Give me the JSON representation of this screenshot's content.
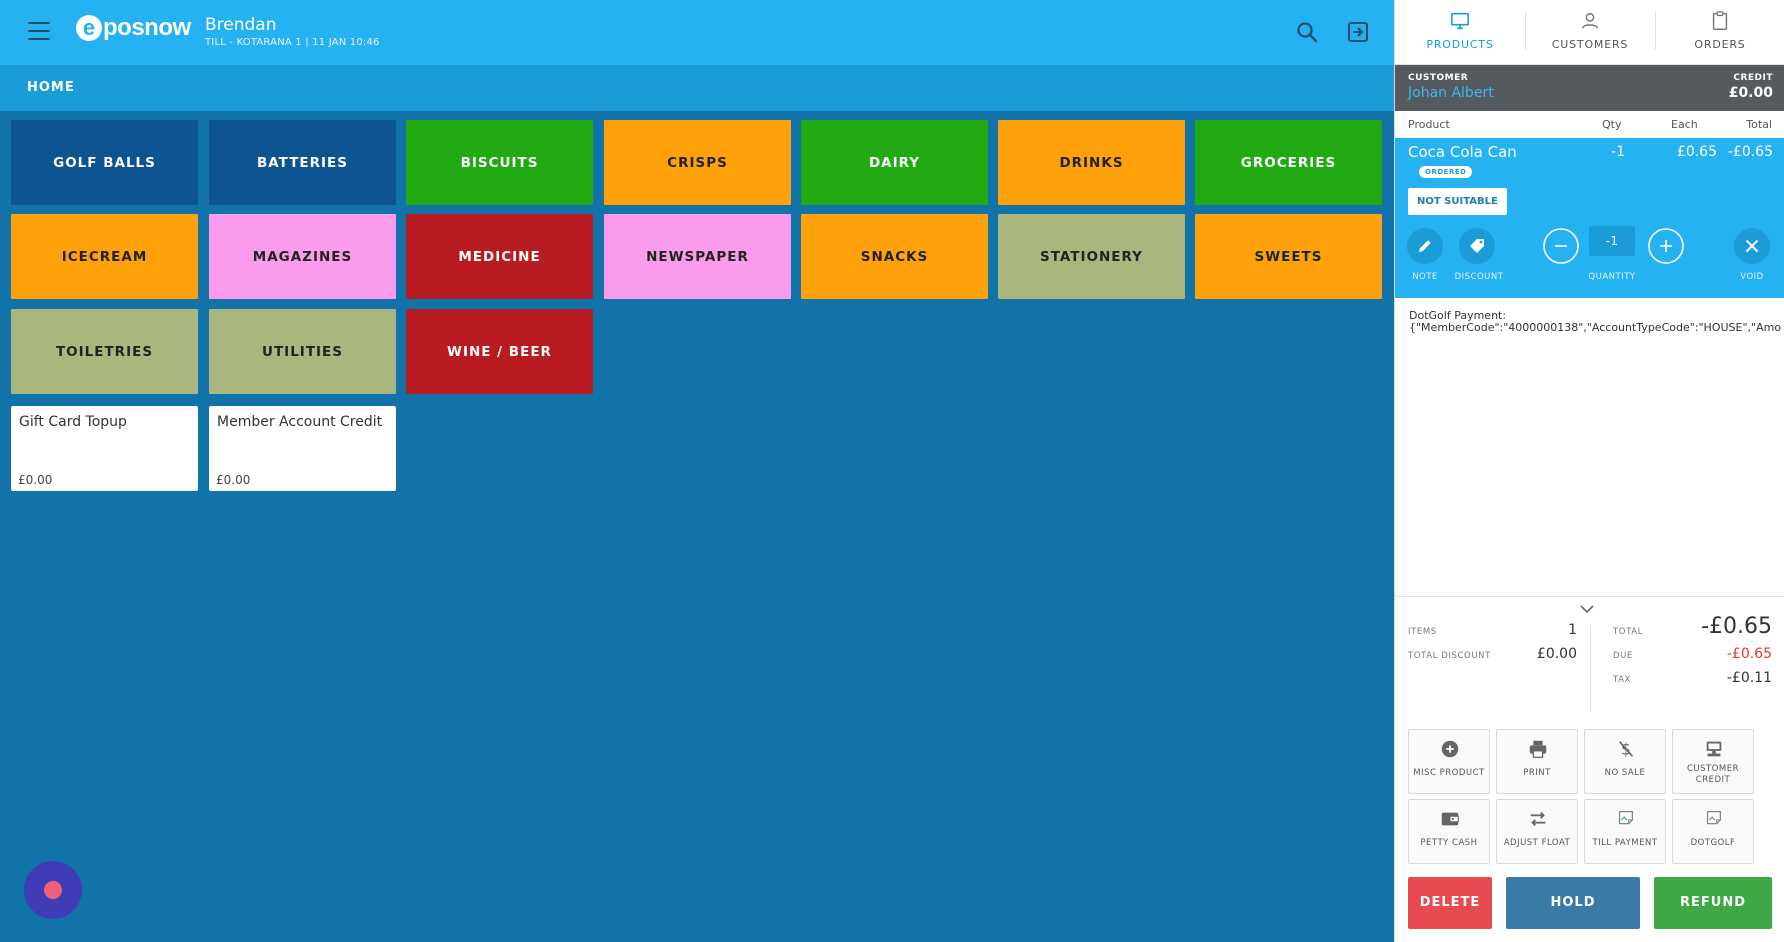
{
  "header": {
    "logo_letter": "e",
    "logo_text": "posnow",
    "user_name": "Brendan",
    "till_info": "TILL - KOTARANA 1 | 11 JAN 10:46"
  },
  "breadcrumb": "HOME",
  "categories": [
    {
      "label": "GOLF BALLS",
      "color": "#0d5491"
    },
    {
      "label": "BATTERIES",
      "color": "#0d5491"
    },
    {
      "label": "BISCUITS",
      "color": "#22aa12"
    },
    {
      "label": "CRISPS",
      "color": "#ffa10a"
    },
    {
      "label": "DAIRY",
      "color": "#22aa12"
    },
    {
      "label": "DRINKS",
      "color": "#ffa10a"
    },
    {
      "label": "GROCERIES",
      "color": "#22aa12"
    },
    {
      "label": "ICECREAM",
      "color": "#ffa10a"
    },
    {
      "label": "MAGAZINES",
      "color": "#fa9beb"
    },
    {
      "label": "MEDICINE",
      "color": "#b81c20"
    },
    {
      "label": "NEWSPAPER",
      "color": "#fa9beb"
    },
    {
      "label": "SNACKS",
      "color": "#ffa10a"
    },
    {
      "label": "STATIONERY",
      "color": "#a9b77e"
    },
    {
      "label": "SWEETS",
      "color": "#ffa10a"
    },
    {
      "label": "TOILETRIES",
      "color": "#a9b77e"
    },
    {
      "label": "UTILITIES",
      "color": "#a9b77e"
    },
    {
      "label": "WINE / BEER",
      "color": "#b81c20"
    }
  ],
  "products": [
    {
      "name": "Gift Card Topup",
      "price": "£0.00"
    },
    {
      "name": "Member Account Credit",
      "price": "£0.00"
    }
  ],
  "panel_tabs": [
    "PRODUCTS",
    "CUSTOMERS",
    "ORDERS"
  ],
  "customer": {
    "label": "CUSTOMER",
    "name": "Johan Albert",
    "credit_label": "CREDIT",
    "credit_value": "£0.00"
  },
  "columns": {
    "product": "Product",
    "qty": "Qty",
    "each": "Each",
    "total": "Total"
  },
  "order_line": {
    "name": "Coca Cola Can",
    "qty": "-1",
    "each": "£0.65",
    "total": "-£0.65",
    "badge": "ORDERED",
    "not_suitable": "NOT SUITABLE",
    "note_label": "NOTE",
    "discount_label": "DISCOUNT",
    "quantity_label": "QUANTITY",
    "quantity_value": "-1",
    "void_label": "VOID"
  },
  "note_text_line1": "DotGolf Payment:",
  "note_text_line2": "{\"MemberCode\":\"4000000138\",\"AccountTypeCode\":\"HOUSE\",\"Amo",
  "summary": {
    "items_label": "ITEMS",
    "items_value": "1",
    "discount_label": "TOTAL DISCOUNT",
    "discount_value": "£0.00",
    "total_label": "TOTAL",
    "total_value": "-£0.65",
    "due_label": "DUE",
    "due_value": "-£0.65",
    "tax_label": "TAX",
    "tax_value": "-£0.11"
  },
  "actions": {
    "misc_product": "MISC PRODUCT",
    "print": "PRINT",
    "no_sale": "NO SALE",
    "customer_credit_1": "CUSTOMER",
    "customer_credit_2": "CREDIT",
    "petty_cash": "PETTY CASH",
    "adjust_float": "ADJUST FLOAT",
    "till_payment": "TILL PAYMENT",
    "dotgolf": "DOTGOLF"
  },
  "buttons": {
    "delete": "DELETE",
    "hold": "HOLD",
    "refund": "REFUND"
  },
  "colors": {
    "topbar": "#25b2f2",
    "background": "#1173a8",
    "delete": "#e84a52",
    "hold": "#3a7aa6",
    "refund": "#3da845",
    "due": "#e53935"
  }
}
